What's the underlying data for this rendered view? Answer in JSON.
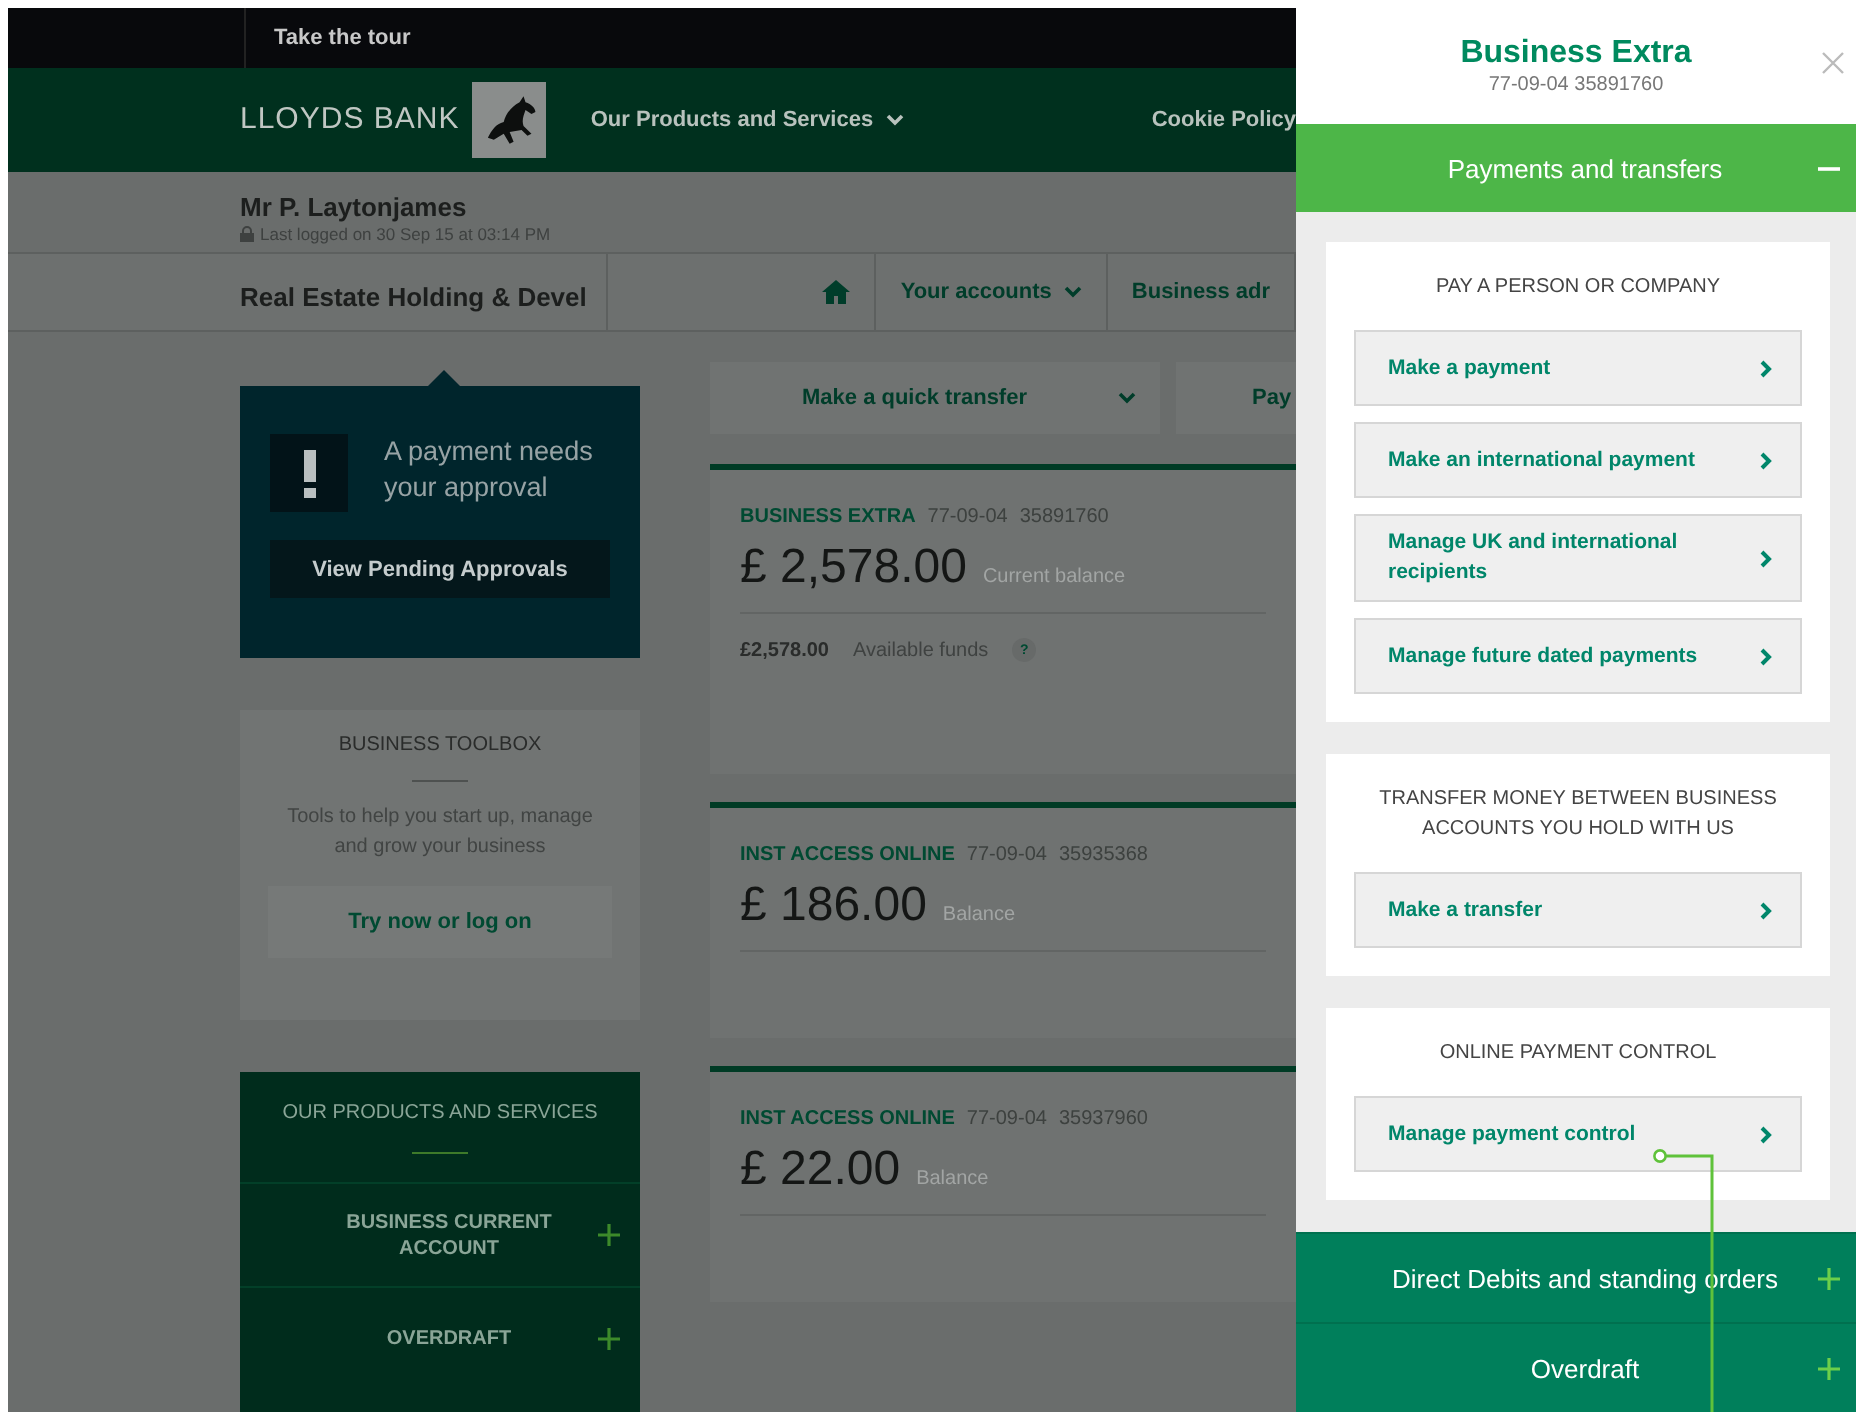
{
  "top_bar": {
    "tour_link": "Take the tour"
  },
  "header": {
    "logo_text": "LLOYDS BANK",
    "nav": [
      {
        "label": "Our Products and Services",
        "dropdown": true
      },
      {
        "label": "Cookie Policy",
        "dropdown": false
      }
    ]
  },
  "user": {
    "name": "Mr P. Laytonjames",
    "last_logged": "Last logged on 30 Sep 15 at 03:14 PM"
  },
  "company_bar": {
    "company": "Real Estate Holding & Devel",
    "nav": [
      {
        "label": "Your accounts",
        "dropdown": true
      },
      {
        "label": "Business adr",
        "dropdown": false
      }
    ]
  },
  "approval": {
    "message": "A payment needs your approval",
    "button": "View Pending Approvals"
  },
  "toolbox": {
    "title": "BUSINESS TOOLBOX",
    "text": "Tools to help you start up, manage and grow your business",
    "button": "Try now or log on"
  },
  "products": {
    "title": "OUR PRODUCTS AND SERVICES",
    "items": [
      {
        "label": "BUSINESS CURRENT ACCOUNT",
        "expanded": false
      },
      {
        "label": "OVERDRAFT",
        "expanded": false
      }
    ]
  },
  "quick_actions": [
    {
      "label": "Make a quick transfer",
      "dropdown": true
    },
    {
      "label": "Pay",
      "dropdown": false
    }
  ],
  "accounts": [
    {
      "name": "BUSINESS EXTRA",
      "sort_code": "77-09-04",
      "number": "35891760",
      "balance": "£ 2,578.00",
      "balance_label": "Current balance",
      "available": "£2,578.00",
      "available_label": "Available funds",
      "help": "?"
    },
    {
      "name": "INST ACCESS ONLINE",
      "sort_code": "77-09-04",
      "number": "35935368",
      "balance": "£ 186.00",
      "balance_label": "Balance"
    },
    {
      "name": "INST ACCESS ONLINE",
      "sort_code": "77-09-04",
      "number": "35937960",
      "balance": "£ 22.00",
      "balance_label": "Balance"
    }
  ],
  "panel": {
    "title": "Business Extra",
    "subtitle": "77-09-04 35891760",
    "sections": [
      {
        "title": "Payments and transfers",
        "expanded": true,
        "groups": [
          {
            "heading": "PAY A PERSON OR COMPANY",
            "links": [
              "Make a payment",
              "Make an international payment",
              "Manage UK and international recipients",
              "Manage future dated payments"
            ]
          },
          {
            "heading": "TRANSFER MONEY BETWEEN BUSINESS ACCOUNTS YOU HOLD WITH US",
            "links": [
              "Make a transfer"
            ]
          },
          {
            "heading": "ONLINE PAYMENT CONTROL",
            "links": [
              "Manage payment control"
            ]
          }
        ]
      },
      {
        "title": "Direct Debits and standing orders",
        "expanded": false
      },
      {
        "title": "Overdraft",
        "expanded": false
      }
    ]
  }
}
